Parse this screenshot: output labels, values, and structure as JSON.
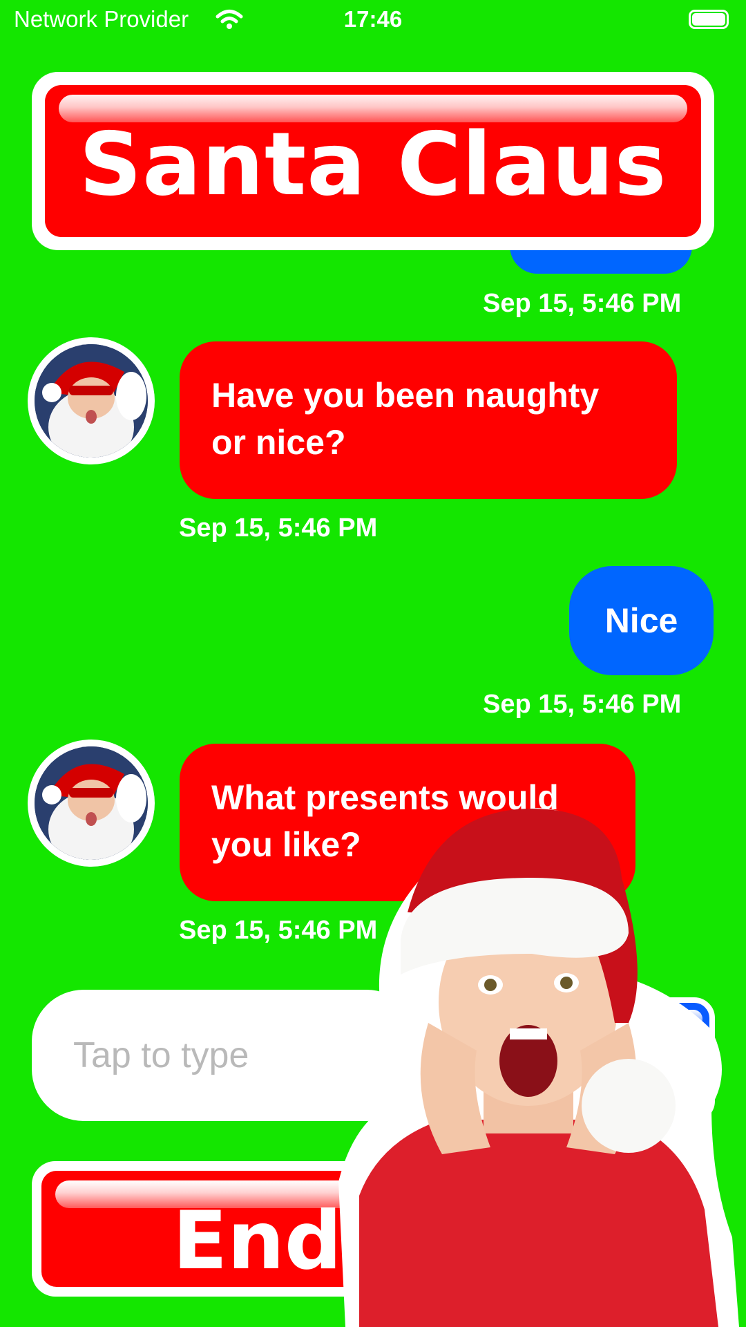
{
  "status_bar": {
    "carrier": "Network Provider",
    "time": "17:46"
  },
  "header": {
    "title": "Santa Claus"
  },
  "messages": [
    {
      "sender": "santa",
      "text_line1": "Have you been naughty",
      "text_line2": "or nice?",
      "time": "Sep 15, 5:46 PM"
    },
    {
      "sender": "user",
      "text": "Nice",
      "time": "Sep 15, 5:46 PM"
    },
    {
      "sender": "santa",
      "text_line1": "What presents would",
      "text_line2": "you like?",
      "time": "Sep 15, 5:46 PM"
    }
  ],
  "previous_message_time": "Sep 15, 5:46 PM",
  "composer": {
    "placeholder": "Tap to type"
  },
  "footer": {
    "end_label": "End"
  },
  "colors": {
    "background": "#14e600",
    "santa_bubble": "#ff0000",
    "user_bubble": "#0066ff"
  }
}
